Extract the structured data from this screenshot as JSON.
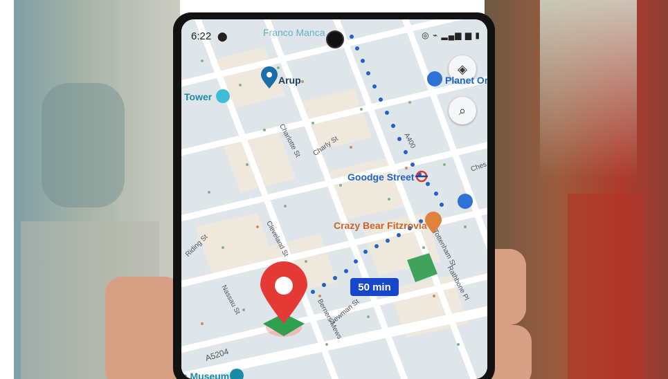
{
  "status_bar": {
    "time": "6:22",
    "icons": "◎ ⌁ ▂▄▆ ▆ ▮"
  },
  "map": {
    "labels": {
      "top": "Franco Manca",
      "arup": "Arup",
      "tower": "Tower",
      "planet": "Planet Or",
      "goodge": "Goodge Street",
      "crazy": "Crazy Bear Fitzrovia",
      "museum": "n Museum",
      "chesterfield": "Ches"
    },
    "streets": {
      "charlotte": "Charlotte St",
      "charly": "Charly St",
      "cleveland": "Cleveland St",
      "riding": "Riding St",
      "nassau": "Nassau St",
      "berners": "Berners Mews",
      "newman": "Newman St",
      "tottenham": "Tottenham St",
      "rathbone": "Rathbone Pl",
      "a400": "A400",
      "a5204": "A5204"
    }
  },
  "route": {
    "eta": "50 min"
  },
  "colors": {
    "route": "#1e63c9",
    "pin": "#e53935",
    "eta_bg": "#1646c9"
  }
}
